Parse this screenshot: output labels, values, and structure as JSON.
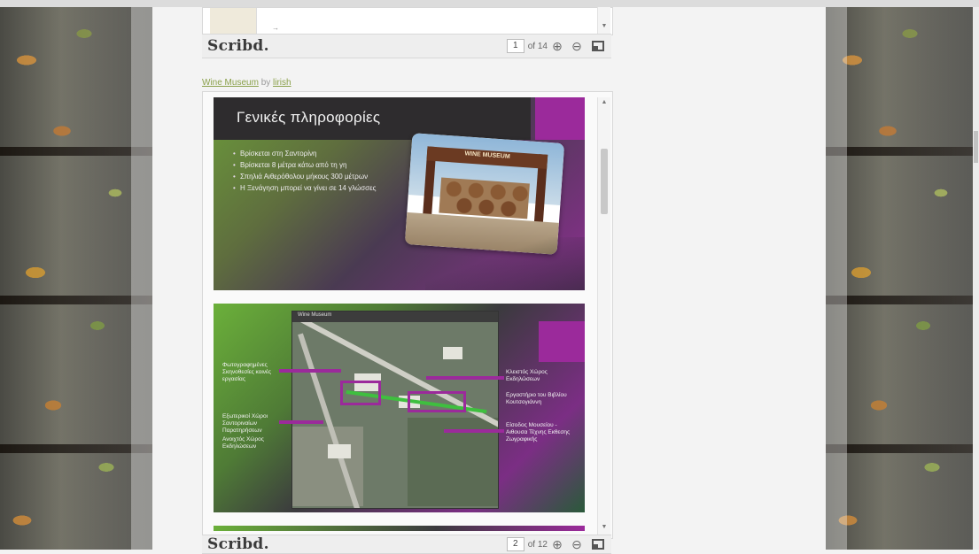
{
  "viewer_top": {
    "logo": "Scribd.",
    "page_input": "1",
    "page_total": "of 14"
  },
  "doc_link": {
    "title": "Wine Museum",
    "by": "by",
    "author": "lirish"
  },
  "slide1": {
    "title": "Γενικές πληροφορίες",
    "bullets": [
      "Βρίσκεται στη Σαντορίνη",
      "Βρίσκεται 8 μέτρα κάτω από τη γη",
      "Σπηλιά Αιθερόθολου μήκους 300 μέτρων",
      "Η Ξενάγηση μπορεί να γίνει σε 14 γλώσσες"
    ],
    "photo_sign": "WINE MUSEUM"
  },
  "slide2": {
    "map_title": "Wine Museum",
    "labels": [
      "Φωτογραφημένες Σκηνοθεσίες κοινές εργασίας",
      "Κλειστός Χώρος Εκδηλώσεων",
      "Εξωτερικοί Χώροι Σαντοριναίων Παρατηρήσεων",
      "Εργαστήριο του Βιβλίου Κουτσογιάννη",
      "Ανοιχτός Χώρος Εκδηλώσεων",
      "Είσοδος Μουσείου - Αιθουσα Τέχνης Εκθεσης Ζωγραφικής"
    ]
  },
  "viewer_bottom": {
    "logo": "Scribd.",
    "page_input": "2",
    "page_total": "of 12"
  },
  "colors": {
    "accent_purple": "#9b2a9b",
    "link_green": "#8aa04a"
  }
}
